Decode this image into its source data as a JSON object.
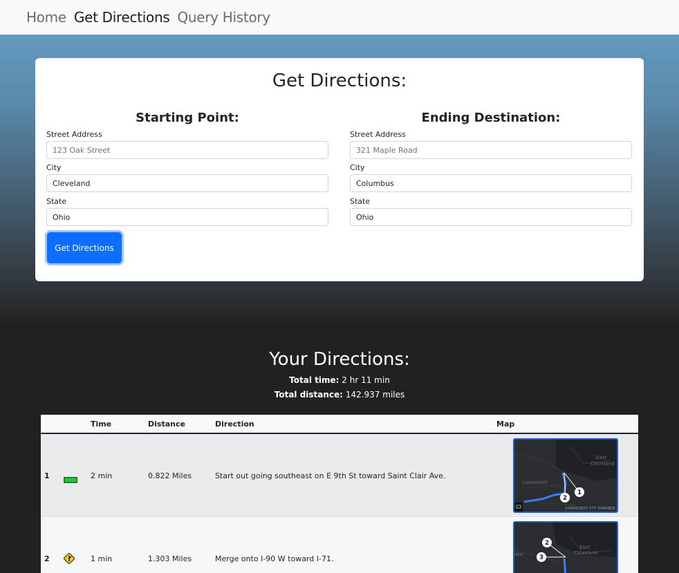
{
  "nav": {
    "items": [
      {
        "label": "Home"
      },
      {
        "label": "Get Directions"
      },
      {
        "label": "Query History"
      }
    ]
  },
  "form": {
    "title": "Get Directions:",
    "start": {
      "heading": "Starting Point:",
      "street_label": "Street Address",
      "street_placeholder": "123 Oak Street",
      "street_value": "",
      "city_label": "City",
      "city_value": "Cleveland",
      "state_label": "State",
      "state_value": "Ohio"
    },
    "end": {
      "heading": "Ending Destination:",
      "street_label": "Street Address",
      "street_placeholder": "321 Maple Road",
      "street_value": "",
      "city_label": "City",
      "city_value": "Columbus",
      "state_label": "State",
      "state_value": "Ohio"
    },
    "submit_label": "Get Directions"
  },
  "results": {
    "title": "Your Directions:",
    "total_time_label": "Total time:",
    "total_time_value": "2 hr 11 min",
    "total_distance_label": "Total distance:",
    "total_distance_value": "142.937 miles",
    "columns": [
      "",
      "",
      "Time",
      "Distance",
      "Direction",
      "Map"
    ],
    "rows": [
      {
        "num": "1",
        "icon": "start-sign-icon",
        "time": "2 min",
        "distance": "0.822 Miles",
        "direction": "Start out going southeast on E 9th St toward Saint Clair Ave.",
        "map_labels": [
          "East",
          "Cleveland",
          "Lakewood"
        ],
        "map_markers": [
          "1",
          "2"
        ],
        "map_credit": "©MAPQUEST ©TT ©MAPBOX"
      },
      {
        "num": "2",
        "icon": "highway-merge-sign-icon",
        "time": "1 min",
        "distance": "1.303 Miles",
        "direction": "Merge onto I-90 W toward I-71.",
        "map_labels": [
          "East",
          "Cleveland",
          "ake"
        ],
        "map_markers": [
          "2",
          "3"
        ],
        "map_credit": ""
      }
    ]
  },
  "colors": {
    "accent": "#0d6efd",
    "route": "#3b7dff",
    "map_bg": "#2b2d30"
  }
}
